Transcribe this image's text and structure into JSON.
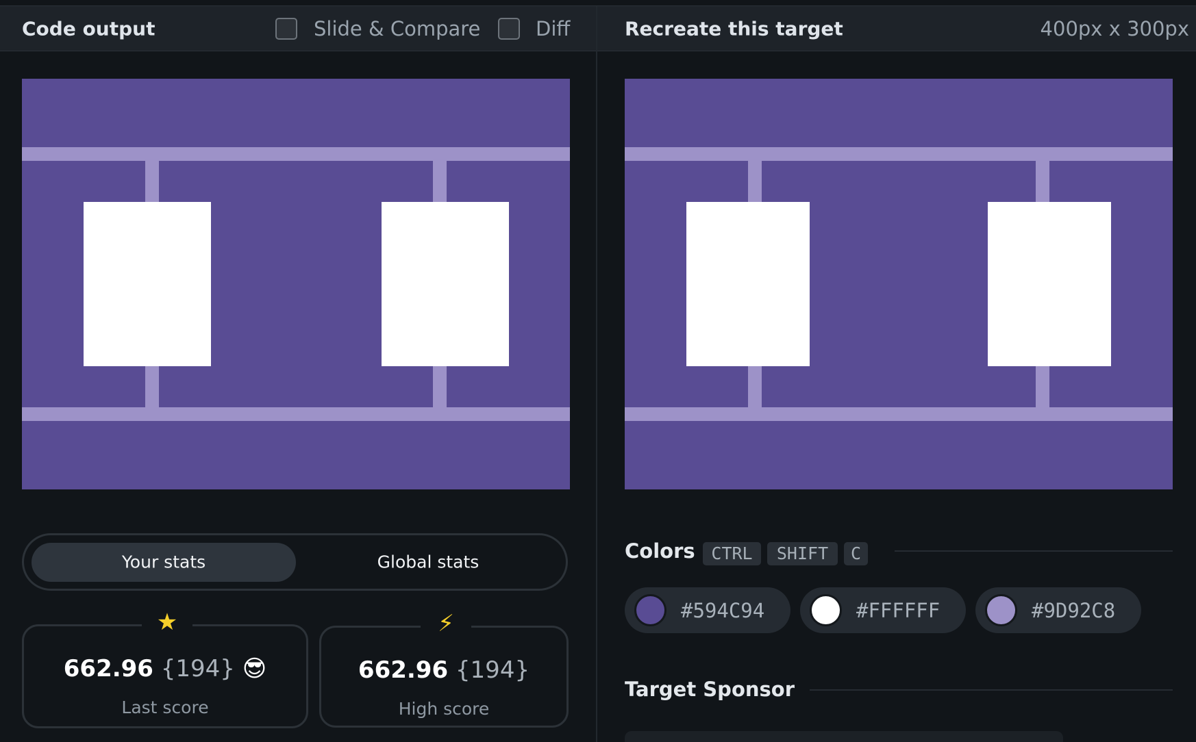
{
  "left_panel": {
    "title": "Code output",
    "slide_compare_label": "Slide & Compare",
    "diff_label": "Diff"
  },
  "right_panel": {
    "title": "Recreate this target",
    "dimensions": "400px x 300px"
  },
  "stats_toggle": {
    "your_stats": "Your stats",
    "global_stats": "Global stats"
  },
  "stats": {
    "last": {
      "score": "662.96",
      "count": "{194}",
      "label": "Last score",
      "emoji": "😎",
      "icon": "star-icon"
    },
    "high": {
      "score": "662.96",
      "count": "{194}",
      "label": "High score",
      "icon": "lightning-icon"
    }
  },
  "colors_section": {
    "title": "Colors",
    "shortcut": [
      "CTRL",
      "SHIFT",
      "C"
    ],
    "swatches": [
      {
        "hex": "#594C94"
      },
      {
        "hex": "#FFFFFF"
      },
      {
        "hex": "#9D92C8"
      }
    ]
  },
  "sponsor_section": {
    "title": "Target Sponsor"
  },
  "palette": {
    "background": "#594C94",
    "boxes": "#FFFFFF",
    "bars": "#9D92C8"
  }
}
